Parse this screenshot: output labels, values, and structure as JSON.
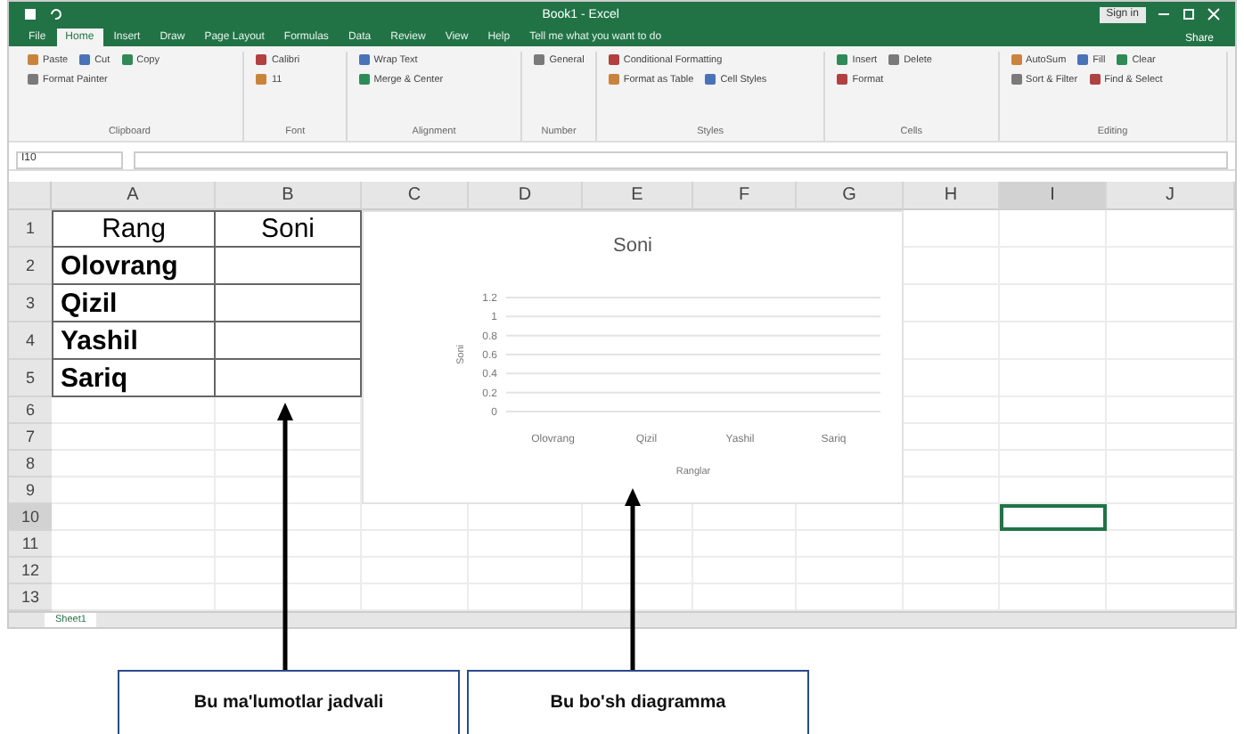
{
  "window": {
    "title": "Book1 - Excel",
    "sign_in": "Sign in"
  },
  "ribbon_tabs": [
    {
      "label": "File",
      "selected": false
    },
    {
      "label": "Home",
      "selected": true
    },
    {
      "label": "Insert",
      "selected": false
    },
    {
      "label": "Draw",
      "selected": false
    },
    {
      "label": "Page Layout",
      "selected": false
    },
    {
      "label": "Formulas",
      "selected": false
    },
    {
      "label": "Data",
      "selected": false
    },
    {
      "label": "Review",
      "selected": false
    },
    {
      "label": "View",
      "selected": false
    },
    {
      "label": "Help",
      "selected": false
    },
    {
      "label": "Tell me what you want to do",
      "selected": false
    }
  ],
  "share": "Share",
  "ribbon_groups": [
    {
      "name": "Clipboard",
      "commands": [
        "Paste",
        "Cut",
        "Copy",
        "Format Painter"
      ]
    },
    {
      "name": "Font",
      "commands": [
        "Calibri",
        "11"
      ]
    },
    {
      "name": "Alignment",
      "commands": [
        "Wrap Text",
        "Merge & Center"
      ]
    },
    {
      "name": "Number",
      "commands": [
        "General"
      ]
    },
    {
      "name": "Styles",
      "commands": [
        "Conditional Formatting",
        "Format as Table",
        "Cell Styles"
      ]
    },
    {
      "name": "Cells",
      "commands": [
        "Insert",
        "Delete",
        "Format"
      ]
    },
    {
      "name": "Editing",
      "commands": [
        "AutoSum",
        "Fill",
        "Clear",
        "Sort & Filter",
        "Find & Select"
      ]
    }
  ],
  "name_box": "I10",
  "columns": [
    {
      "label": "A",
      "selected": false
    },
    {
      "label": "B",
      "selected": false
    },
    {
      "label": "C",
      "selected": false
    },
    {
      "label": "D",
      "selected": false
    },
    {
      "label": "E",
      "selected": false
    },
    {
      "label": "F",
      "selected": false
    },
    {
      "label": "G",
      "selected": false
    },
    {
      "label": "H",
      "selected": false
    },
    {
      "label": "I",
      "selected": true
    },
    {
      "label": "J",
      "selected": false
    }
  ],
  "rows": [
    {
      "number": "1",
      "selected": false,
      "cells": [
        "Rang",
        "Soni"
      ]
    },
    {
      "number": "2",
      "selected": false,
      "cells": [
        "Olovrang"
      ]
    },
    {
      "number": "3",
      "selected": false,
      "cells": [
        "Qizil"
      ]
    },
    {
      "number": "4",
      "selected": false,
      "cells": [
        "Yashil"
      ]
    },
    {
      "number": "5",
      "selected": false,
      "cells": [
        "Sariq"
      ]
    },
    {
      "number": "6",
      "selected": false
    },
    {
      "number": "7",
      "selected": false
    },
    {
      "number": "8",
      "selected": false
    },
    {
      "number": "9",
      "selected": false
    },
    {
      "number": "10",
      "selected": true
    },
    {
      "number": "11",
      "selected": false
    },
    {
      "number": "12",
      "selected": false
    },
    {
      "number": "13",
      "selected": false
    }
  ],
  "chart": {
    "chart_data": {
      "type": "bar",
      "grid": true,
      "title": "Soni",
      "xlabel": "Ranglar",
      "ylabel": "Soni",
      "categories": [
        "Olovrang",
        "Qizil",
        "Yashil",
        "Sariq"
      ],
      "values": [
        null,
        null,
        null,
        null
      ],
      "yticks": [
        0,
        0.2,
        0.4,
        0.6,
        0.8,
        1,
        1.2
      ],
      "ylim": [
        0,
        1.2
      ]
    }
  },
  "sheet_tabs": [
    {
      "label": "Sheet1",
      "selected": true
    }
  ],
  "callouts": [
    {
      "text": "Bu ma'lumotlar jadvali"
    },
    {
      "text": "Bu bo'sh diagramma"
    }
  ]
}
